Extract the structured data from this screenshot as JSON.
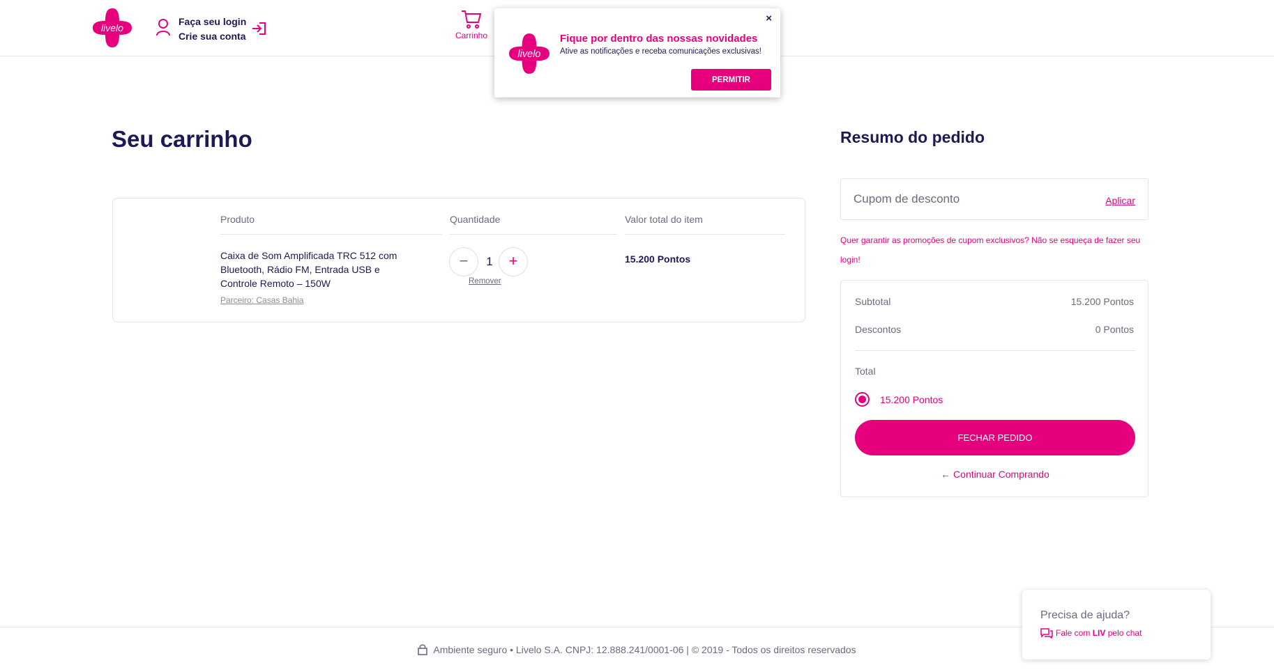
{
  "brand": {
    "logo_text": "livelo",
    "accent": "#e6007e",
    "navy": "#1b1a55"
  },
  "header": {
    "login_title": "Faça seu login",
    "login_subtitle": "Crie sua conta",
    "cart_label": "Carrinho"
  },
  "notification": {
    "title": "Fique por dentro das nossas novidades",
    "text": "Ative as notificações e receba comunicações exclusivas!",
    "allow_label": "PERMITIR",
    "close_label": "×"
  },
  "cart": {
    "title": "Seu carrinho",
    "columns": {
      "product": "Produto",
      "quantity": "Quantidade",
      "total": "Valor total do item"
    },
    "item": {
      "name": "Caixa de Som Amplificada TRC 512 com Bluetooth, Rádio FM, Entrada USB e Controle Remoto – 150W",
      "partner": "Parceiro: Casas Bahia",
      "quantity": "1",
      "minus": "−",
      "plus": "+",
      "remove_label": "Remover",
      "total": "15.200 Pontos"
    }
  },
  "summary": {
    "title": "Resumo do pedido",
    "coupon_placeholder": "Cupom de desconto",
    "coupon_apply": "Aplicar",
    "promo_note": "Quer garantir as promoções de cupom exclusivos? Não se esqueça de fazer seu login!",
    "subtotal_label": "Subtotal",
    "subtotal_value": "15.200 Pontos",
    "discount_label": "Descontos",
    "discount_value": "0 Pontos",
    "total_label": "Total",
    "total_option": "15.200 Pontos",
    "checkout_label": "FECHAR PEDIDO",
    "continue_label": "← Continuar Comprando"
  },
  "footer": {
    "text": "Ambiente seguro • Livelo S.A. CNPJ: 12.888.241/0001-06 | © 2019 - Todos os direitos reservados"
  },
  "help": {
    "title": "Precisa de ajuda?",
    "link_prefix": "Fale com",
    "link_brand": "LIV",
    "link_suffix": "pelo chat"
  }
}
